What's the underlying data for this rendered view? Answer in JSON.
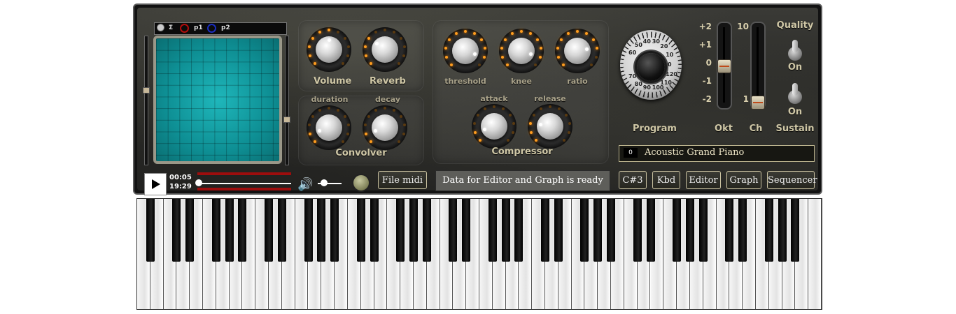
{
  "scope": {
    "legend": {
      "sigma": "Σ",
      "p1": "p1",
      "p2": "p2"
    }
  },
  "transport": {
    "elapsed": "00:05",
    "total": "19:29",
    "file_button": "File midi"
  },
  "status_message": "Data for Editor and Graph is ready",
  "effects": {
    "volume": "Volume",
    "reverb": "Reverb",
    "duration": "duration",
    "decay": "decay",
    "convolver": "Convolver"
  },
  "compressor": {
    "threshold": "threshold",
    "knee": "knee",
    "ratio": "ratio",
    "attack": "attack",
    "release": "release",
    "title": "Compressor"
  },
  "program": {
    "label": "Program",
    "number": "0",
    "name": "Acoustic Grand Piano",
    "dial_numbers": [
      "60",
      "50",
      "40",
      "30",
      "20",
      "10",
      "0",
      "120",
      "110",
      "100",
      "90",
      "80",
      "70"
    ]
  },
  "octave": {
    "label": "Okt",
    "scale": [
      "+2",
      "+1",
      "0",
      "-1",
      "-2"
    ]
  },
  "channel": {
    "label": "Ch",
    "scale_top": "10",
    "scale_bottom": "1"
  },
  "quality": {
    "label": "Quality",
    "state": "On"
  },
  "sustain": {
    "label": "Sustain",
    "state": "On"
  },
  "nav_buttons": {
    "key": "C#3",
    "kbd": "Kbd",
    "editor": "Editor",
    "graph": "Graph",
    "sequencer": "Sequencer"
  },
  "colors": {
    "accent_led": "#ff9d1f",
    "scope": "#16a3a8",
    "progress_bar": "#9d0d0d"
  },
  "piano": {
    "white_keys": 52
  }
}
